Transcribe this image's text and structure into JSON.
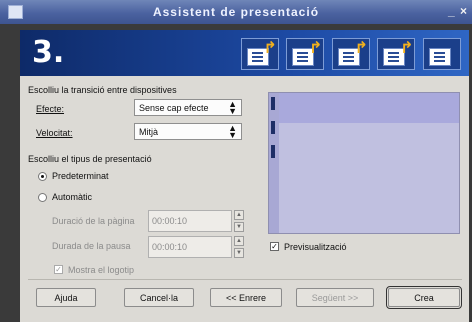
{
  "window": {
    "title": "Assistent de presentació",
    "minimize": "_",
    "close": "×"
  },
  "banner": {
    "step": "3."
  },
  "transition": {
    "heading": "Escolliu la transició entre dispositives",
    "effect_label": "Efecte:",
    "effect_value": "Sense cap efecte",
    "speed_label": "Velocitat:",
    "speed_value": "Mitjà"
  },
  "presentation": {
    "heading": "Escolliu el tipus de presentació",
    "default_label": "Predeterminat",
    "auto_label": "Automàtic",
    "default_selected": true,
    "page_duration_label": "Duració de la pàgina",
    "page_duration_value": "00:00:10",
    "pause_duration_label": "Durada de la pausa",
    "pause_duration_value": "00:00:10",
    "show_logo_label": "Mostra el logotip",
    "show_logo_checked": true
  },
  "preview": {
    "label": "Previsualització",
    "checked": true
  },
  "buttons": {
    "help": "Ajuda",
    "cancel": "Cancel·la",
    "back": "<< Enrere",
    "next": "Següent >>",
    "create": "Crea"
  },
  "colors": {
    "titlebar": "#4b62a0",
    "banner": "#1d4aa4",
    "dialog_bg": "#dcdad5",
    "preview_bg": "#c0c0e0"
  }
}
